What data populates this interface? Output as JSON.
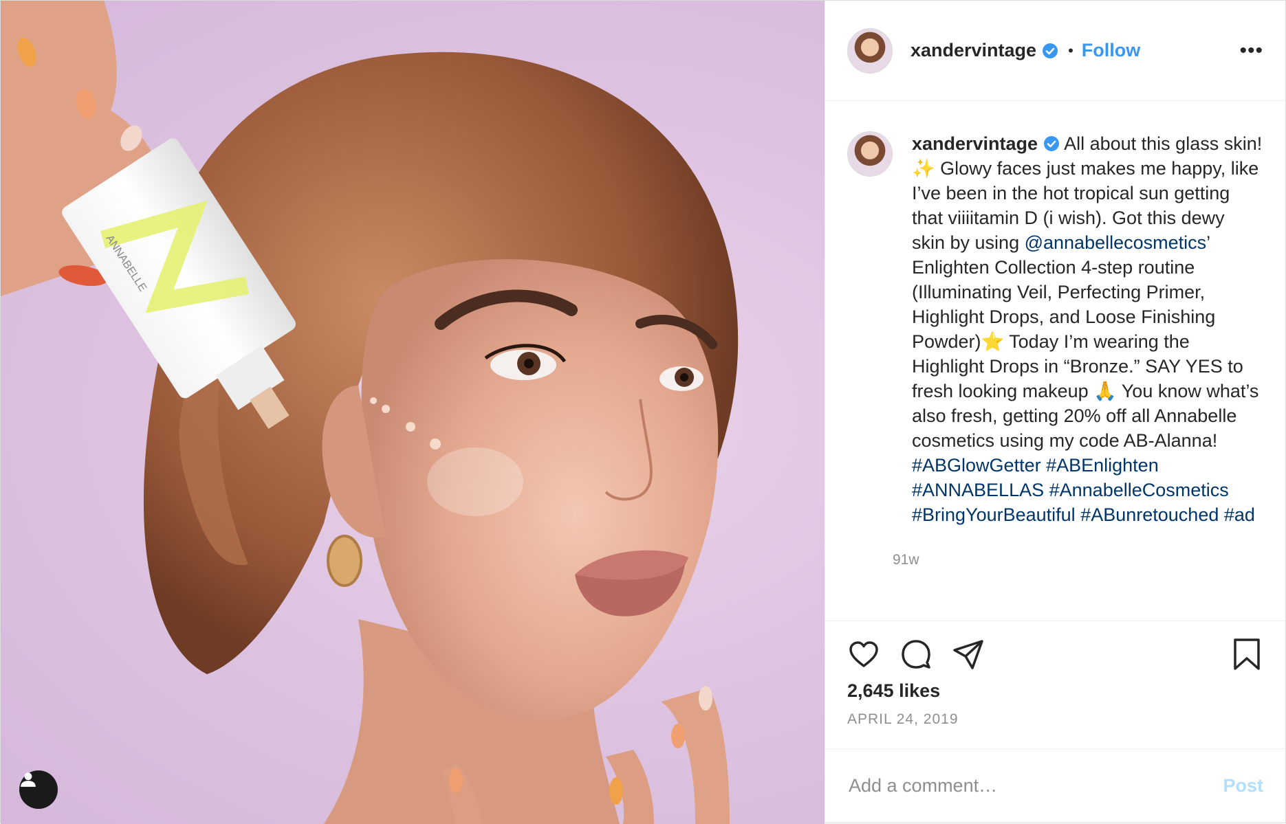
{
  "post": {
    "username": "xandervintage",
    "follow_label": "Follow",
    "separator": "•",
    "more_label": "•••",
    "caption": {
      "text_1": "All about this glass skin! ✨ Glowy faces just makes me happy, like I’ve been in the hot tropical sun getting that viiiitamin D (i wish). Got this dewy skin by using ",
      "mention": "@annabellecosmetics",
      "text_2": "’ Enlighten Collection 4-step routine (Illuminating Veil, Perfecting Primer, Highlight Drops, and Loose Finishing Powder)⭐ Today I’m wearing the Highlight Drops in “Bronze.” SAY YES to fresh looking makeup 🙏 You know what’s also fresh, getting 20% off all Annabelle cosmetics using my code AB-Alanna!",
      "hashtags": [
        "#ABGlowGetter",
        "#ABEnlighten",
        "#ANNABELLAS",
        "#AnnabelleCosmetics",
        "#BringYourBeautiful",
        "#ABunretouched",
        "#ad"
      ]
    },
    "time_ago": "91w",
    "likes": "2,645 likes",
    "date": "APRIL 24, 2019",
    "comment_placeholder": "Add a comment…",
    "post_label": "Post",
    "product_brand": "ANNABELLE"
  },
  "colors": {
    "link": "#003569",
    "follow": "#3897f0",
    "verified": "#3897f0",
    "post_disabled": "#b2dffc",
    "muted": "#8e8e8e"
  },
  "icons": [
    "heart-icon",
    "comment-icon",
    "share-icon",
    "bookmark-icon",
    "verified-icon",
    "user-tag-icon"
  ]
}
